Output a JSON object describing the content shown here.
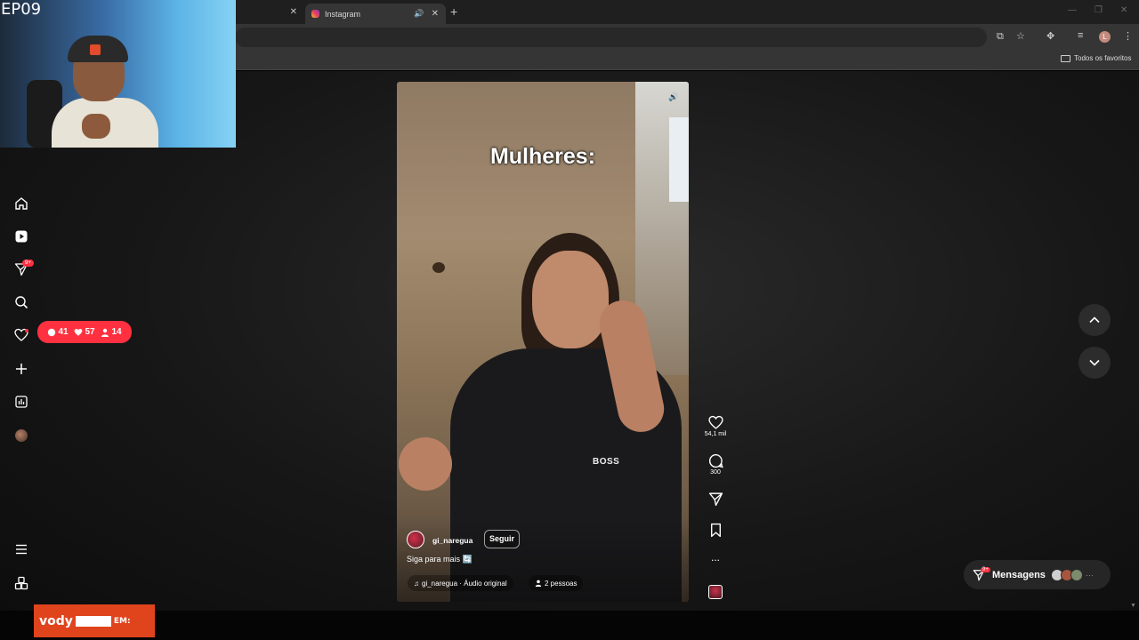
{
  "overlay": {
    "episode": "EP09"
  },
  "browser": {
    "active_tab": {
      "title": "Instagram"
    },
    "bookmarks_folder": "Todos os favoritos",
    "profile_initial": "L"
  },
  "nav": {
    "messages_badge": "9+",
    "notifications": {
      "comments": "41",
      "likes": "57",
      "follows": "14"
    }
  },
  "reel": {
    "title_text": "Mulheres:",
    "shirt_text": "BOSS",
    "author": "gi_naregua",
    "follow_label": "Seguir",
    "caption": "Siga para mais 🔄",
    "audio": "gi_naregua · Áudio original",
    "people": "2 pessoas",
    "likes": "54,1 mil",
    "comments": "300",
    "more": "..."
  },
  "messages": {
    "label": "Mensagens",
    "badge": "9+"
  },
  "stream_banner": {
    "brand": "vody",
    "suffix": "EM:"
  },
  "colors": {
    "accent": "#ff3040",
    "page_bg": "#171717",
    "chrome_bg": "#353535"
  }
}
